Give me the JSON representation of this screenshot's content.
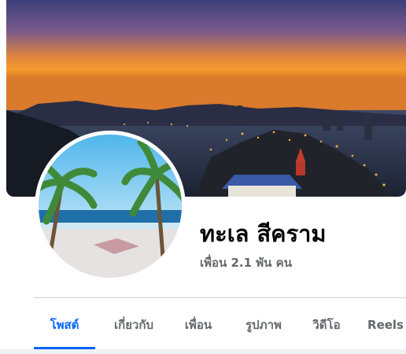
{
  "profile": {
    "name": "ทะเล สีคราม",
    "friends_text": "เพื่อน 2.1 พัน คน"
  },
  "tabs": [
    {
      "label": "โพสต์",
      "active": true
    },
    {
      "label": "เกี่ยวกับ",
      "active": false
    },
    {
      "label": "เพื่อน",
      "active": false
    },
    {
      "label": "รูปภาพ",
      "active": false
    },
    {
      "label": "วิดีโอ",
      "active": false
    },
    {
      "label": "Reels",
      "active": false
    }
  ],
  "colors": {
    "accent": "#0866ff",
    "name_text": "#050505",
    "secondary_text": "#65676b"
  }
}
